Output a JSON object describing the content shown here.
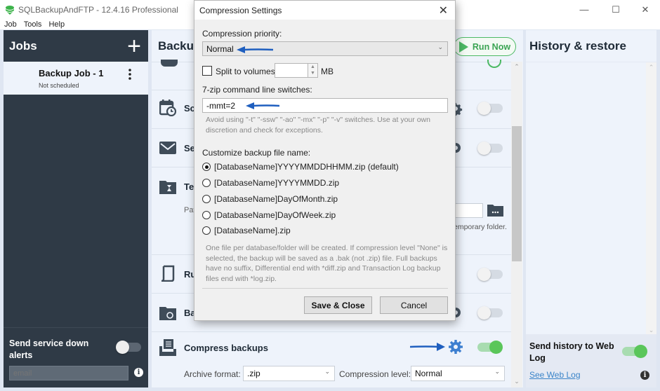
{
  "app": {
    "title": "SQLBackupAndFTP - 12.4.16 Professional",
    "window_controls": {
      "minimize": "—",
      "maximize": "☐",
      "close": "✕"
    }
  },
  "menu": [
    "Job",
    "Tools",
    "Help"
  ],
  "jobs_panel": {
    "title": "Jobs",
    "add_icon": "+",
    "jobs": [
      {
        "name": "Backup Job - 1",
        "status": "Not scheduled"
      }
    ],
    "alerts": {
      "label": "Send service down alerts",
      "toggle_on": false,
      "email_placeholder": "email",
      "info_icon": "i"
    }
  },
  "center_panel": {
    "title": "Backup",
    "run_now_label": "Run Now",
    "sections": [
      {
        "id": "schedule",
        "label": "Sc",
        "toggle_on": false
      },
      {
        "id": "send",
        "label": "Se",
        "toggle_on": false
      },
      {
        "id": "temp",
        "label": "Te",
        "path_label": "Pat",
        "note": "emporary folder."
      },
      {
        "id": "run",
        "label": "Ru",
        "toggle_on": false
      },
      {
        "id": "backup",
        "label": "Ba",
        "toggle_on": false
      },
      {
        "id": "compress",
        "label": "Compress backups",
        "toggle_on": true
      }
    ],
    "compress": {
      "archive_format_label": "Archive format:",
      "archive_format_value": ".zip",
      "compression_level_label": "Compression level:",
      "compression_level_value": "Normal"
    }
  },
  "history_panel": {
    "title": "History & restore",
    "weblog_label": "Send history to Web Log",
    "weblog_toggle_on": true,
    "weblog_link": "See Web Log",
    "info_icon": "i"
  },
  "dialog": {
    "title": "Compression Settings",
    "close_icon": "✕",
    "priority_label": "Compression priority:",
    "priority_value": "Normal",
    "split_label": "Split to volumes:",
    "split_checked": false,
    "split_value": "",
    "split_unit": "MB",
    "switches_label": "7-zip command line switches:",
    "switches_value": "-mmt=2",
    "switches_hint": "Avoid using \"-t\" \"-ssw\" \"-ao\" \"-mx\" \"-p\" \"-v\" switches. Use at your own discretion and check for exceptions.",
    "filename_label": "Customize backup file name:",
    "filename_options": [
      {
        "label": "[DatabaseName]YYYYMMDDHHMM.zip (default)",
        "checked": true
      },
      {
        "label": "[DatabaseName]YYYYMMDD.zip",
        "checked": false
      },
      {
        "label": "[DatabaseName]DayOfMonth.zip",
        "checked": false
      },
      {
        "label": "[DatabaseName]DayOfWeek.zip",
        "checked": false
      },
      {
        "label": "[DatabaseName].zip",
        "checked": false
      }
    ],
    "filename_hint": "One file per database/folder will be created. If compression level \"None\" is selected, the backup will be saved as a .bak (not .zip) file. Full backups have no suffix, Differential end with *diff.zip and Transaction Log backup files end with *log.zip.",
    "save_label": "Save & Close",
    "cancel_label": "Cancel"
  },
  "colors": {
    "accent_green": "#4cb964",
    "toggle_on": "#5ac65a",
    "sidebar_dark": "#2f3a46",
    "annotation_arrow": "#1f5fbf",
    "gear_blue": "#3d7fd0",
    "link_blue": "#3a84c9"
  }
}
